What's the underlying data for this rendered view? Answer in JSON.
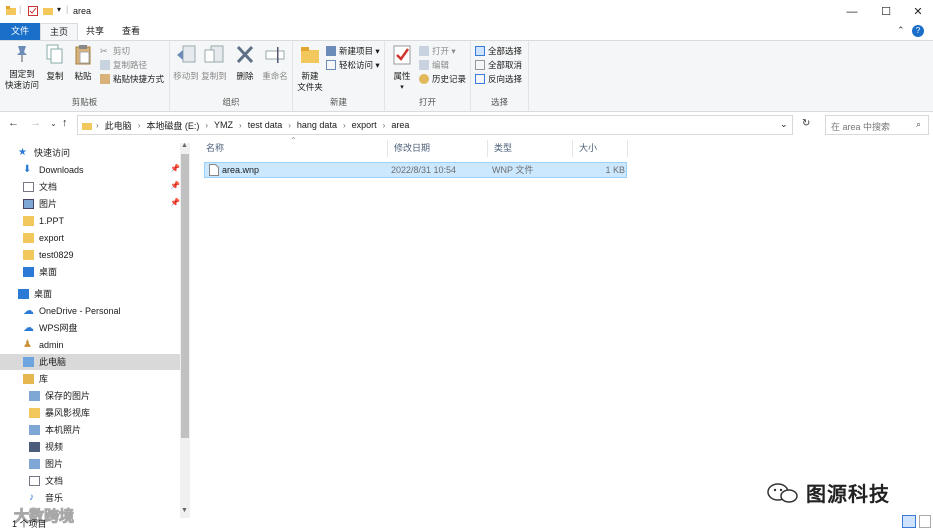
{
  "window": {
    "title": "area",
    "minimize": "—",
    "maximize": "☐",
    "close": "✕"
  },
  "tabs": [
    {
      "label": "文件"
    },
    {
      "label": "主页"
    },
    {
      "label": "共享"
    },
    {
      "label": "查看"
    }
  ],
  "ribbon": {
    "clipboard": {
      "group_label": "剪贴板",
      "pin": "固定到\n快速访问",
      "copy": "复制",
      "paste": "粘贴",
      "cut": "剪切",
      "copy_path": "复制路径",
      "paste_shortcut": "粘贴快捷方式"
    },
    "organize": {
      "group_label": "组织",
      "move_to": "移动到",
      "copy_to": "复制到",
      "delete": "删除",
      "rename": "重命名"
    },
    "new": {
      "group_label": "新建",
      "new_folder": "新建\n文件夹",
      "new_item": "新建项目",
      "easy_access": "轻松访问"
    },
    "open": {
      "group_label": "打开",
      "properties": "属性",
      "open": "打开",
      "edit": "编辑",
      "history": "历史记录"
    },
    "select": {
      "group_label": "选择",
      "select_all": "全部选择",
      "select_none": "全部取消",
      "invert": "反向选择"
    }
  },
  "address": {
    "breadcrumb": [
      "此电脑",
      "本地磁盘 (E:)",
      "YMZ",
      "test data",
      "hang data",
      "export",
      "area"
    ],
    "search_placeholder": "在 area 中搜索"
  },
  "nav": {
    "quick_access": "快速访问",
    "items": [
      {
        "label": "Downloads"
      },
      {
        "label": "文档"
      },
      {
        "label": "图片"
      },
      {
        "label": "1.PPT"
      },
      {
        "label": "export"
      },
      {
        "label": "test0829"
      },
      {
        "label": "桌面"
      },
      {
        "label": "桌面"
      },
      {
        "label": "OneDrive - Personal"
      },
      {
        "label": "WPS网盘"
      },
      {
        "label": "admin"
      },
      {
        "label": "此电脑"
      },
      {
        "label": "库"
      },
      {
        "label": "保存的图片"
      },
      {
        "label": "暴风影视库"
      },
      {
        "label": "本机照片"
      },
      {
        "label": "视频"
      },
      {
        "label": "图片"
      },
      {
        "label": "文档"
      },
      {
        "label": "音乐"
      }
    ]
  },
  "columns": {
    "name": "名称",
    "date": "修改日期",
    "type": "类型",
    "size": "大小"
  },
  "files": [
    {
      "name": "area.wnp",
      "date": "2022/8/31 10:54",
      "type": "WNP 文件",
      "size": "1 KB"
    }
  ],
  "status": {
    "count": "1 个项目"
  },
  "watermark": {
    "brand": "图源科技",
    "corner": "大数跨境"
  },
  "colors": {
    "accent": "#1a6fc9",
    "folder": "#f2c75c",
    "selection": "#cce8ff"
  }
}
